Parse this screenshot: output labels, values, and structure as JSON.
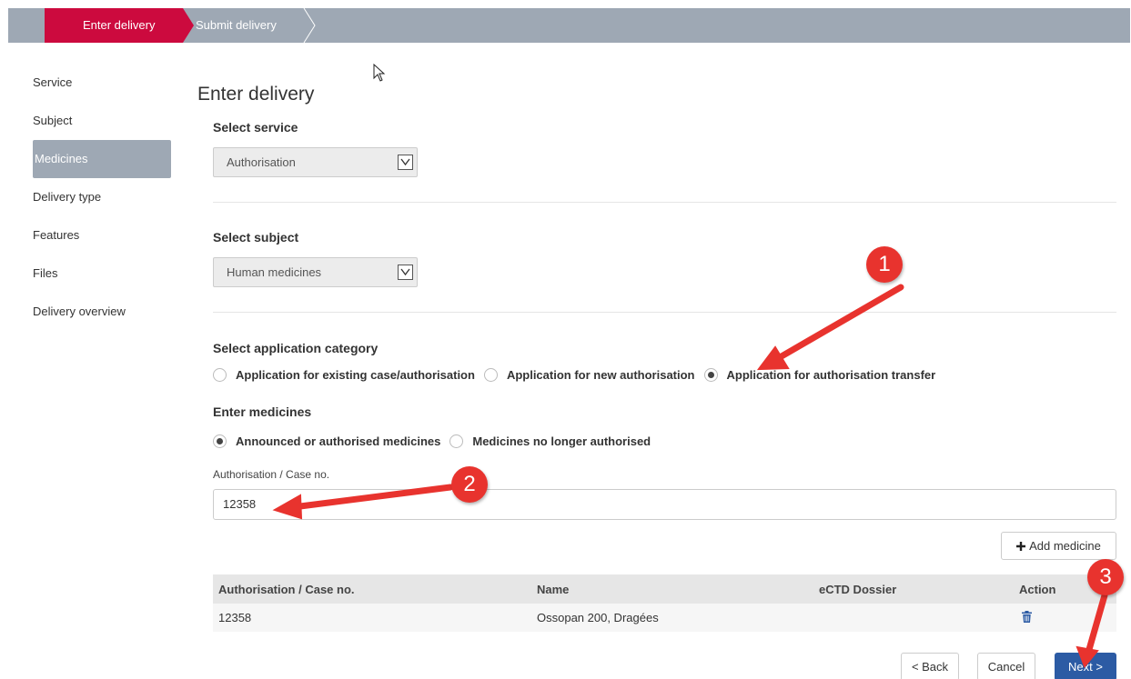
{
  "progress": {
    "steps": [
      {
        "label": "Enter delivery",
        "active": true
      },
      {
        "label": "Submit delivery",
        "active": false
      }
    ]
  },
  "sidebar": {
    "items": [
      {
        "label": "Service"
      },
      {
        "label": "Subject"
      },
      {
        "label": "Medicines",
        "active": true
      },
      {
        "label": "Delivery type"
      },
      {
        "label": "Features"
      },
      {
        "label": "Files"
      },
      {
        "label": "Delivery overview"
      }
    ]
  },
  "main": {
    "title": "Enter delivery",
    "service": {
      "label": "Select service",
      "value": "Authorisation"
    },
    "subject": {
      "label": "Select subject",
      "value": "Human medicines"
    },
    "category": {
      "label": "Select application category",
      "options": [
        {
          "label": "Application for existing case/authorisation",
          "checked": false
        },
        {
          "label": "Application for new authorisation",
          "checked": false
        },
        {
          "label": "Application for authorisation transfer",
          "checked": true
        }
      ]
    },
    "medicines": {
      "label": "Enter medicines",
      "options": [
        {
          "label": "Announced or authorised medicines",
          "checked": true
        },
        {
          "label": "Medicines no longer authorised",
          "checked": false
        }
      ]
    },
    "case_field": {
      "label": "Authorisation / Case no.",
      "value": "12358"
    },
    "add_button": "Add medicine",
    "table": {
      "headers": [
        "Authorisation / Case no.",
        "Name",
        "eCTD Dossier",
        "Action"
      ],
      "rows": [
        {
          "case_no": "12358",
          "name": "Ossopan 200, Dragées",
          "ectd": ""
        }
      ]
    },
    "buttons": {
      "back": "< Back",
      "cancel": "Cancel",
      "next": "Next >"
    }
  },
  "annotations": {
    "badge_1": "1",
    "badge_2": "2",
    "badge_3": "3",
    "color": "#e8332e"
  },
  "colors": {
    "accent": "#cc0a3e",
    "bar": "#9ea8b4",
    "primary_button": "#2c5ba4"
  }
}
